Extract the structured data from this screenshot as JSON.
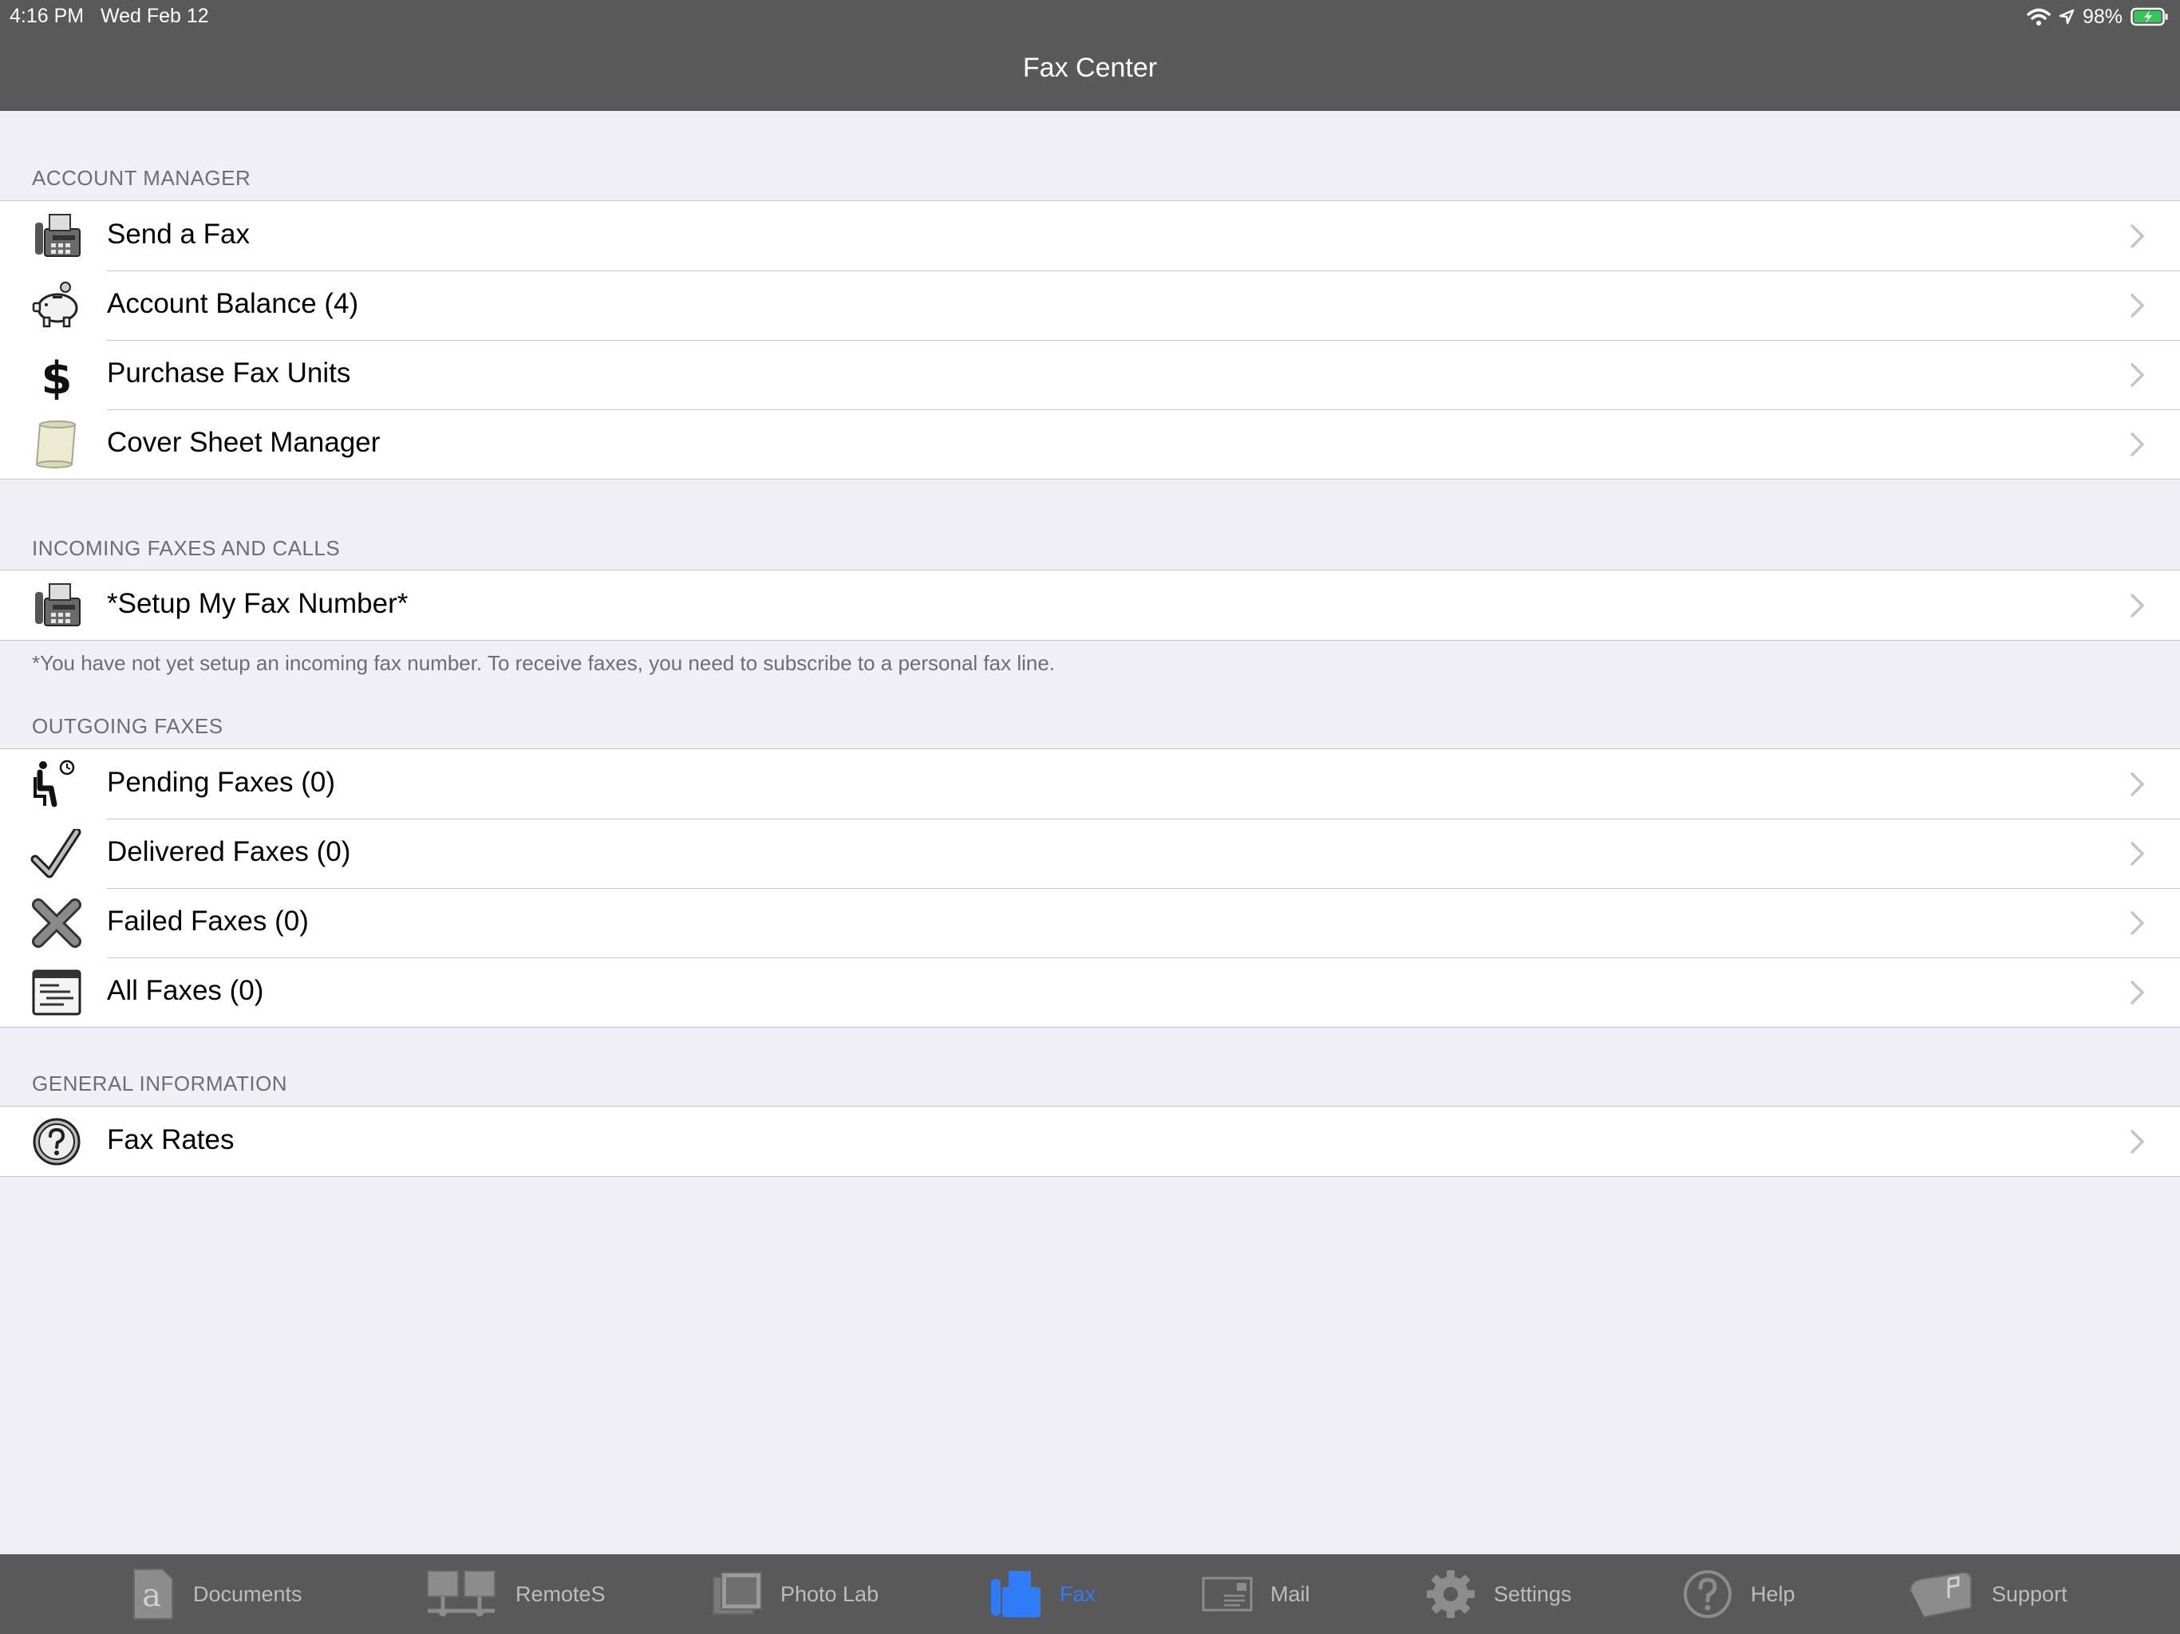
{
  "status_bar": {
    "time": "4:16 PM",
    "date": "Wed Feb 12",
    "battery": "98%"
  },
  "nav": {
    "title": "Fax Center"
  },
  "sections": [
    {
      "header": "ACCOUNT MANAGER",
      "items": [
        {
          "label": "Send a Fax",
          "icon": "fax-machine-icon"
        },
        {
          "label": "Account Balance (4)",
          "icon": "piggy-bank-icon"
        },
        {
          "label": "Purchase Fax Units",
          "icon": "dollar-sign-icon"
        },
        {
          "label": "Cover Sheet Manager",
          "icon": "scroll-icon"
        }
      ]
    },
    {
      "header": "INCOMING FAXES AND CALLS",
      "items": [
        {
          "label": "*Setup My Fax Number*",
          "icon": "fax-machine-icon"
        }
      ],
      "footer": "*You have not yet setup an incoming fax number. To receive faxes, you need to subscribe to a personal fax line."
    },
    {
      "header": "OUTGOING FAXES",
      "items": [
        {
          "label": "Pending Faxes (0)",
          "icon": "waiting-person-icon"
        },
        {
          "label": "Delivered Faxes (0)",
          "icon": "checkmark-icon"
        },
        {
          "label": "Failed Faxes (0)",
          "icon": "x-mark-icon"
        },
        {
          "label": "All Faxes (0)",
          "icon": "list-window-icon"
        }
      ]
    },
    {
      "header": "GENERAL INFORMATION",
      "items": [
        {
          "label": "Fax Rates",
          "icon": "question-circle-icon"
        }
      ]
    }
  ],
  "tabs": [
    {
      "label": "Documents",
      "icon": "document-icon"
    },
    {
      "label": "RemoteS",
      "icon": "network-computers-icon"
    },
    {
      "label": "Photo Lab",
      "icon": "photos-icon"
    },
    {
      "label": "Fax",
      "icon": "fax-icon",
      "active": true
    },
    {
      "label": "Mail",
      "icon": "envelope-icon"
    },
    {
      "label": "Settings",
      "icon": "gear-icon"
    },
    {
      "label": "Help",
      "icon": "help-icon"
    },
    {
      "label": "Support",
      "icon": "mailbox-icon"
    }
  ],
  "colors": {
    "nav_bg": "#595959",
    "active_tab": "#2f7cf6",
    "page_bg": "#f0eff5"
  }
}
